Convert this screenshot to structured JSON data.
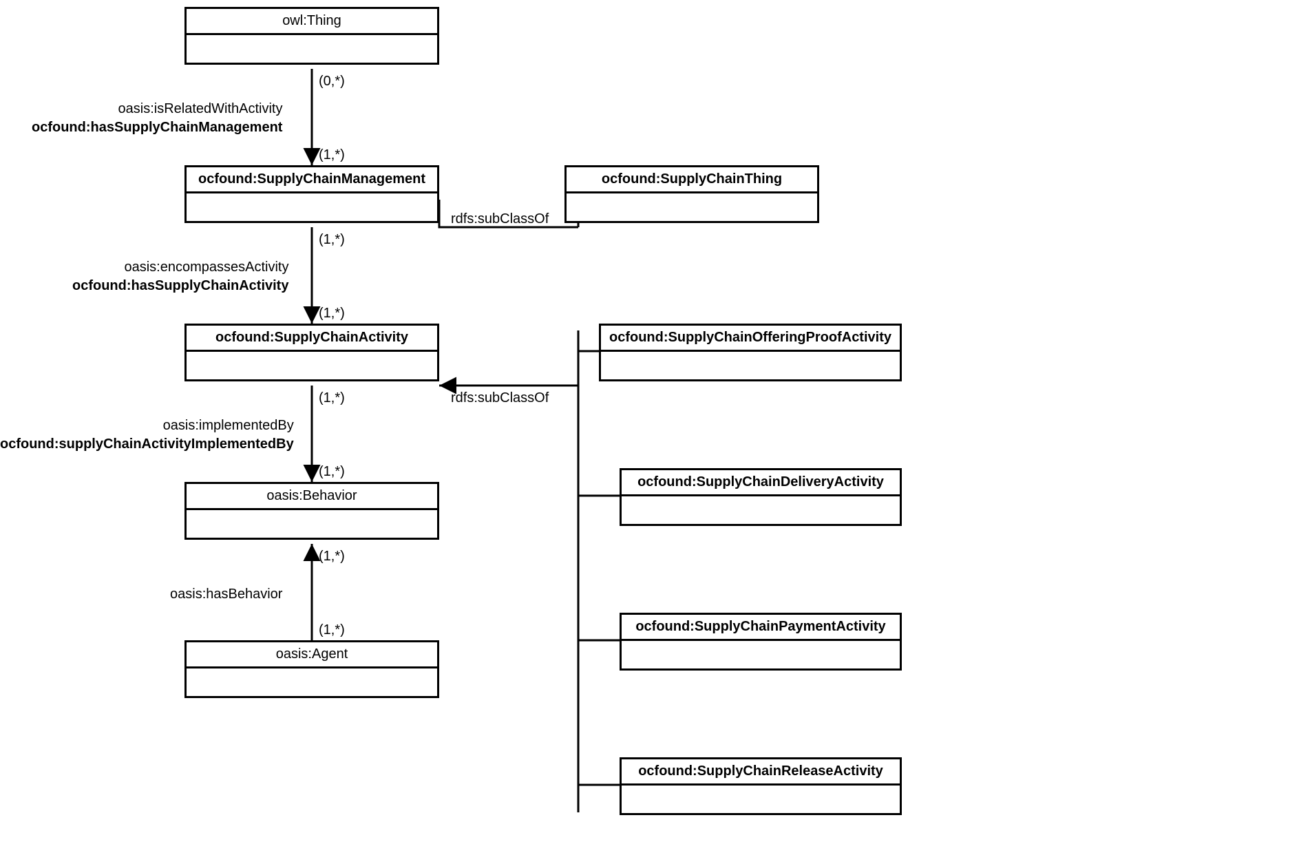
{
  "classes": {
    "thing": "owl:Thing",
    "scm": "ocfound:SupplyChainManagement",
    "sct": "ocfound:SupplyChainThing",
    "sca": "ocfound:SupplyChainActivity",
    "scopa": "ocfound:SupplyChainOfferingProofActivity",
    "scda": "ocfound:SupplyChainDeliveryActivity",
    "scpa": "ocfound:SupplyChainPaymentActivity",
    "scra": "ocfound:SupplyChainReleaseActivity",
    "behavior": "oasis:Behavior",
    "agent": "oasis:Agent"
  },
  "edges": {
    "thing_scm": {
      "top": "oasis:isRelatedWithActivity",
      "bottom": "ocfound:hasSupplyChainManagement",
      "card_top": "(0,*)",
      "card_bottom": "(1,*)"
    },
    "scm_sca": {
      "top": "oasis:encompassesActivity",
      "bottom": "ocfound:hasSupplyChainActivity",
      "card_top": "(1,*)",
      "card_bottom": "(1,*)"
    },
    "sca_behavior": {
      "top": "oasis:implementedBy",
      "bottom": "ocfound:supplyChainActivityImplementedBy",
      "card_top": "(1,*)",
      "card_bottom": "(1,*)"
    },
    "agent_behavior": {
      "label": "oasis:hasBehavior",
      "card_top": "(1,*)",
      "card_bottom": "(1,*)"
    },
    "scm_sct": {
      "label": "rdfs:subClassOf"
    },
    "sca_subclasses": {
      "label": "rdfs:subClassOf"
    }
  }
}
